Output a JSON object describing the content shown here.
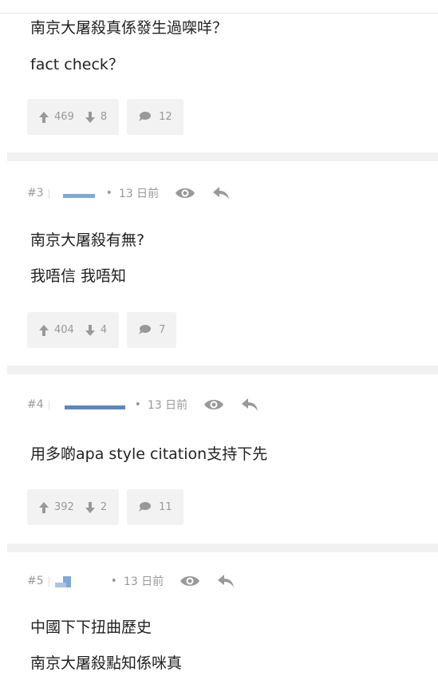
{
  "posts": [
    {
      "lines": [
        "南京大屠殺真係發生過㗎咩？",
        "fact check？"
      ],
      "upvotes": "469",
      "downvotes": "8",
      "comments": "12"
    },
    {
      "number": "#3",
      "age": "13 日前",
      "lines": [
        "南京大屠殺有無?",
        "我唔信 我唔知"
      ],
      "upvotes": "404",
      "downvotes": "4",
      "comments": "7"
    },
    {
      "number": "#4",
      "age": "13 日前",
      "lines": [
        "用多啲apa style citation支持下先"
      ],
      "upvotes": "392",
      "downvotes": "2",
      "comments": "11"
    },
    {
      "number": "#5",
      "age": "13 日前",
      "lines": [
        "中國下下扭曲歷史",
        "南京大屠殺點知係咪真"
      ]
    }
  ],
  "icons": {
    "upvote": "arrow-up-icon",
    "downvote": "arrow-down-icon",
    "comment": "speech-bubble-icon",
    "view": "eye-icon",
    "reply": "reply-icon"
  },
  "colors": {
    "muted": "#999999",
    "text": "#222222",
    "pill": "#f2f2f2",
    "divider": "#f1f1f1"
  }
}
